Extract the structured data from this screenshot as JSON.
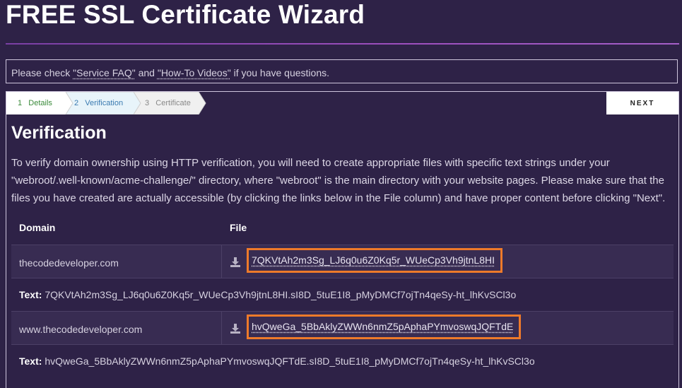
{
  "page": {
    "title": "FREE SSL Certificate Wizard"
  },
  "notice": {
    "prefix": "Please check ",
    "faq": "\"Service FAQ\"",
    "middle": " and ",
    "videos": "\"How-To Videos\"",
    "suffix": " if you have questions."
  },
  "steps": [
    {
      "num": "1",
      "label": "Details",
      "state": "done",
      "color": "#3a8a3a"
    },
    {
      "num": "2",
      "label": "Verification",
      "state": "active",
      "color": "#3a7ab0"
    },
    {
      "num": "3",
      "label": "Certificate",
      "state": "todo",
      "color": "#888888"
    }
  ],
  "next_label": "NEXT",
  "section": {
    "heading": "Verification",
    "description": "To verify domain ownership using HTTP verification, you will need to create appropriate files with specific text strings under your \"webroot/.well-known/acme-challenge/\" directory, where \"webroot\" is the main directory with your website pages. Please make sure that the files you have created are actually accessible (by clicking the links below in the File column) and have proper content before clicking \"Next\"."
  },
  "table": {
    "columns": [
      "Domain",
      "File"
    ],
    "text_label": "Text:",
    "rows": [
      {
        "domain": "thecodedeveloper.com",
        "file": "7QKVtAh2m3Sg_LJ6q0u6Z0Kq5r_WUeCp3Vh9jtnL8HI",
        "text": "7QKVtAh2m3Sg_LJ6q0u6Z0Kq5r_WUeCp3Vh9jtnL8HI.sI8D_5tuE1I8_pMyDMCf7ojTn4qeSy-ht_lhKvSCl3o"
      },
      {
        "domain": "www.thecodedeveloper.com",
        "file": "hvQweGa_5BbAklyZWWn6nmZ5pAphaPYmvoswqJQFTdE",
        "text": "hvQweGa_5BbAklyZWWn6nmZ5pAphaPYmvoswqJQFTdE.sI8D_5tuE1I8_pMyDMCf7ojTn4qeSy-ht_lhKvSCl3o"
      }
    ]
  },
  "colors": {
    "background": "#2e2247",
    "highlight": "#ee7a2a",
    "accent_rule": "#9d4fbe"
  },
  "icons": {
    "download": "download-icon"
  }
}
